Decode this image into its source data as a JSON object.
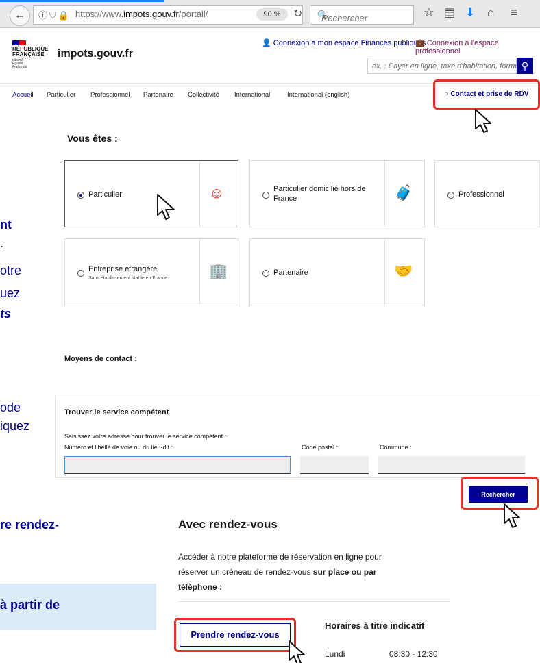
{
  "browser": {
    "url_prefix": "https://www.",
    "url_domain": "impots.gouv.fr",
    "url_path": "/portail/",
    "zoom": "90 %",
    "search_placeholder": "Rechercher"
  },
  "header": {
    "rf_line1": "RÉPUBLIQUE",
    "rf_line2": "FRANÇAISE",
    "devise": "Liberté\nÉgalité\nFraternité",
    "site_name": "impots.gouv.fr",
    "link_particulier": "Connexion à mon espace Finances publiques",
    "link_pro": "Connexion à l'espace professionnel",
    "search_placeholder": "ex. : Payer en ligne, taxe d'habitation, formulaire"
  },
  "nav": {
    "items": [
      "Accueil",
      "Particulier",
      "Professionnel",
      "Partenaire",
      "Collectivité",
      "International",
      "International (english)"
    ],
    "contact": "Contact et prise de RDV"
  },
  "left_cut": {
    "t1": "nt",
    "t2": ".",
    "t3": "otre",
    "t4": "uez",
    "t5": "ts",
    "t6": "ode",
    "t7": "iquez",
    "t8": "re rendez-",
    "t9": "à partir de"
  },
  "vous_etes": {
    "title": "Vous êtes :",
    "cards": [
      {
        "label": "Particulier",
        "selected": true
      },
      {
        "label": "Particulier domicilié hors de France"
      },
      {
        "label": "Professionnel"
      },
      {
        "label": "Entreprise étrangère",
        "sub": "Sans établissement stable en France"
      },
      {
        "label": "Partenaire"
      }
    ]
  },
  "contact": {
    "title": "Moyens de contact :",
    "box_title": "Trouver le service compétent",
    "instruction": "Saisissez votre adresse pour trouver le service compétent :",
    "f_voie": "Numéro et libellé de voie ou du lieu-dit :",
    "f_cp": "Code postal :",
    "f_commune": "Commune :",
    "search_btn": "Rechercher"
  },
  "rdv": {
    "title": "Avec rendez-vous",
    "text1": "Accéder à notre plateforme de réservation en ligne pour",
    "text2": "réserver un créneau de rendez-vous ",
    "text2b": "sur place ou par",
    "text3": "téléphone :",
    "btn": "Prendre rendez-vous",
    "hours_title": "Horaires à titre indicatif",
    "day": "Lundi",
    "time": "08:30 - 12:30"
  }
}
